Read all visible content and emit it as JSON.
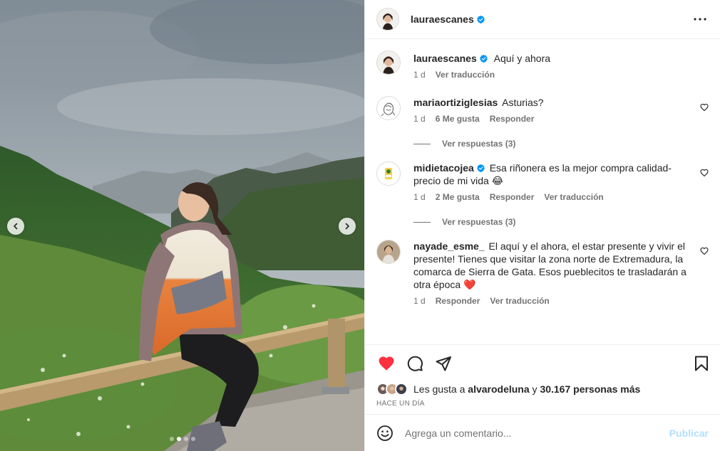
{
  "post": {
    "username": "lauraescanes",
    "verified": true,
    "photo_position": {
      "current": 2,
      "total": 4
    }
  },
  "caption": {
    "username": "lauraescanes",
    "text": "Aquí y ahora",
    "time": "1 d",
    "translate": "Ver traducción"
  },
  "comments": [
    {
      "username": "mariaortiziglesias",
      "verified": false,
      "text": "Asturias?",
      "time": "1 d",
      "likes": "6 Me gusta",
      "reply": "Responder",
      "replies_link": "Ver respuestas (3)"
    },
    {
      "username": "midietacojea",
      "verified": true,
      "text": "Esa riñonera es la mejor compra calidad-precio de mi vida 😂",
      "time": "1 d",
      "likes": "2 Me gusta",
      "reply": "Responder",
      "translate": "Ver traducción",
      "replies_link": "Ver respuestas (3)"
    },
    {
      "username": "nayade_esme_",
      "verified": false,
      "text": "El aquí y el ahora, el estar presente y vivir el presente! Tienes que visitar la zona norte de Extremadura, la comarca de Sierra de Gata. Esos pueblecitos te trasladarán a otra época ❤️",
      "time": "1 d",
      "reply": "Responder",
      "translate": "Ver traducción"
    }
  ],
  "likes": {
    "prefix": "Les gusta a",
    "user": "alvarodeluna",
    "connector": "y",
    "others": "30.167 personas más"
  },
  "timestamp": "HACE UN DÍA",
  "add_comment": {
    "placeholder": "Agrega un comentario...",
    "publish": "Publicar"
  },
  "colors": {
    "like_red": "#ff3040",
    "verified_blue": "#0095f6",
    "publish_disabled": "#b2dffc",
    "secondary_text": "#737373"
  },
  "icons": {
    "header": "more-horizontal-icon",
    "actions": [
      "heart-filled-icon",
      "comment-icon",
      "share-icon",
      "bookmark-icon"
    ],
    "comment_like": "heart-outline-icon",
    "carousel": [
      "chevron-left-icon",
      "chevron-right-icon"
    ],
    "composer": "emoji-icon"
  }
}
